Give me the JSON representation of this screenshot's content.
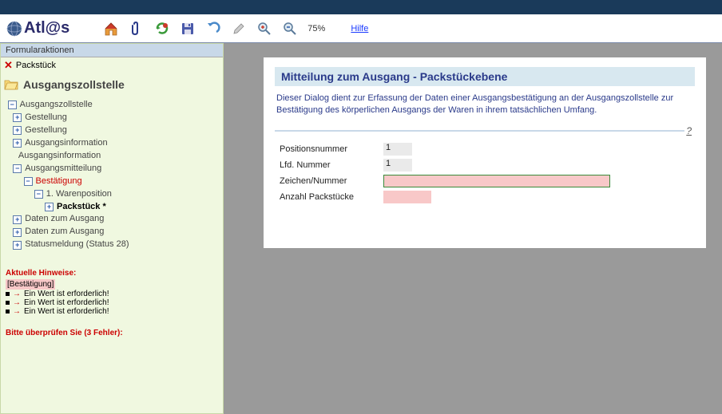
{
  "toolbar": {
    "logo": "Atl@s",
    "zoom": "75%",
    "help": "Hilfe"
  },
  "sidebar": {
    "formActions": "Formularaktionen",
    "packstueck": "Packstück",
    "mainTitle": "Ausgangszollstelle",
    "tree": {
      "root": "Ausgangszollstelle",
      "gestellung1": "Gestellung",
      "gestellung2": "Gestellung",
      "ausgangsinfo1": "Ausgangsinformation",
      "ausgangsinfo2": "Ausgangsinformation",
      "ausgangsmitteilung": "Ausgangsmitteilung",
      "bestaetigung": "Bestätigung",
      "warenposition": "1. Warenposition",
      "packstueck": "Packstück *",
      "datenAusgang1": "Daten zum Ausgang",
      "datenAusgang2": "Daten zum Ausgang",
      "statusmeldung": "Statusmeldung (Status 28)"
    },
    "hintsTitle": "Aktuelle Hinweise:",
    "hintCategory": "[Bestätigung]",
    "hintMsg": "Ein Wert ist erforderlich!",
    "checkTitle": "Bitte überprüfen Sie (3 Fehler):"
  },
  "panel": {
    "title": "Mitteilung zum Ausgang - Packstückebene",
    "desc": "Dieser Dialog dient zur Erfassung der Daten einer Ausgangsbestätigung an der Ausgangszollstelle zur Bestätigung des körperlichen Ausgangs der Waren in ihrem tatsächlichen Umfang.",
    "help": "?",
    "fields": {
      "posNr": {
        "label": "Positionsnummer",
        "value": "1"
      },
      "lfdNr": {
        "label": "Lfd. Nummer",
        "value": "1"
      },
      "zeichen": {
        "label": "Zeichen/Nummer"
      },
      "anzahl": {
        "label": "Anzahl Packstücke"
      }
    }
  }
}
